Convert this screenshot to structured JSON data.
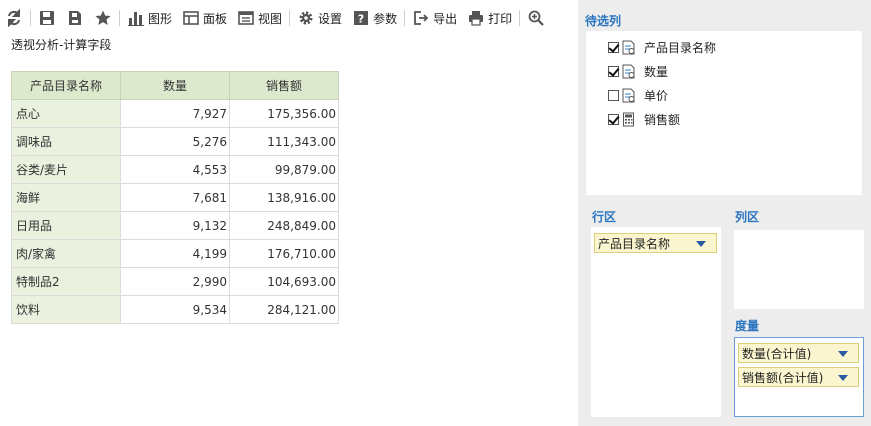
{
  "toolbar": {
    "chart_label": "图形",
    "panel_label": "面板",
    "view_label": "视图",
    "settings_label": "设置",
    "params_label": "参数",
    "export_label": "导出",
    "print_label": "打印"
  },
  "page": {
    "title": "透视分析-计算字段"
  },
  "table": {
    "headers": [
      "产品目录名称",
      "数量",
      "销售额"
    ],
    "rows": [
      {
        "name": "点心",
        "qty": "7,927",
        "sales": "175,356.00"
      },
      {
        "name": "调味品",
        "qty": "5,276",
        "sales": "111,343.00"
      },
      {
        "name": "谷类/麦片",
        "qty": "4,553",
        "sales": "99,879.00"
      },
      {
        "name": "海鲜",
        "qty": "7,681",
        "sales": "138,916.00"
      },
      {
        "name": "日用品",
        "qty": "9,132",
        "sales": "248,849.00"
      },
      {
        "name": "肉/家禽",
        "qty": "4,199",
        "sales": "176,710.00"
      },
      {
        "name": "特制品2",
        "qty": "2,990",
        "sales": "104,693.00"
      },
      {
        "name": "饮料",
        "qty": "9,534",
        "sales": "284,121.00"
      }
    ]
  },
  "panel": {
    "candidates_title": "待选列",
    "candidates": [
      {
        "label": "产品目录名称",
        "checked": true
      },
      {
        "label": "数量",
        "checked": true
      },
      {
        "label": "单价",
        "checked": false
      },
      {
        "label": "销售额",
        "checked": true
      }
    ],
    "rows_title": "行区",
    "rows_items": [
      "产品目录名称"
    ],
    "cols_title": "列区",
    "measures_title": "度量",
    "measures_items": [
      "数量(合计值)",
      "销售额(合计值)"
    ]
  },
  "colors": {
    "accent": "#2a74c0",
    "header_bg": "#dde9cc",
    "rowhead_bg": "#eaf1df",
    "chip_bg": "#fbf6cf",
    "panel_bg": "#ededed"
  }
}
